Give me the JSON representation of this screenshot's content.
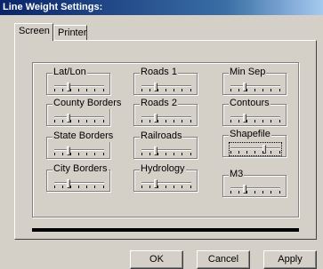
{
  "window": {
    "title": "Line Weight Settings:"
  },
  "tabs": [
    {
      "label": "Screen",
      "active": true
    },
    {
      "label": "Printer",
      "active": false
    }
  ],
  "groups": {
    "lat_lon": {
      "label": "Lat/Lon"
    },
    "county_borders": {
      "label": "County Borders"
    },
    "state_borders": {
      "label": "State Borders"
    },
    "city_borders": {
      "label": "City Borders"
    },
    "roads1": {
      "label": "Roads 1"
    },
    "roads2": {
      "label": "Roads 2"
    },
    "railroads": {
      "label": "Railroads"
    },
    "hydrology": {
      "label": "Hydrology"
    },
    "min_sep": {
      "label": "Min Sep"
    },
    "contours": {
      "label": "Contours"
    },
    "shapefile": {
      "label": "Shapefile"
    },
    "m3": {
      "label": "M3"
    }
  },
  "buttons": {
    "ok": "OK",
    "cancel": "Cancel",
    "apply": "Apply"
  },
  "colors": {
    "titlebar_start": "#0a246a",
    "titlebar_end": "#a6caf0",
    "face": "#d4d0c8"
  }
}
